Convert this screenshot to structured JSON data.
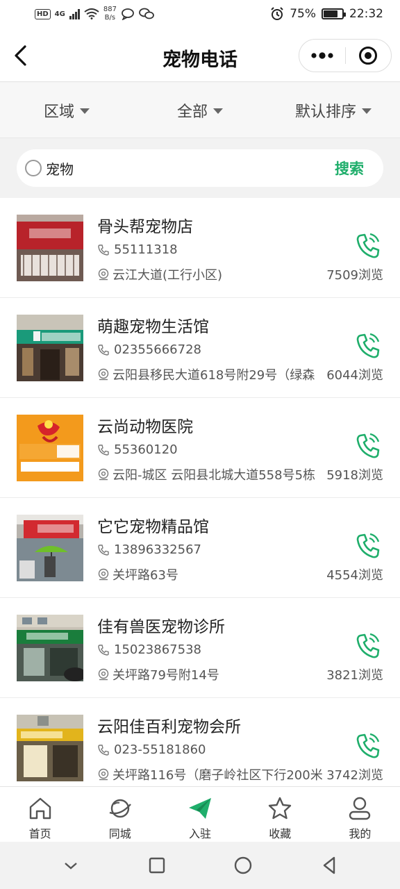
{
  "status": {
    "hd": "HD",
    "net": "4G",
    "speed_value": "887",
    "speed_unit": "B/s",
    "battery": "75%",
    "battery_level": 0.75,
    "time": "22:32"
  },
  "nav": {
    "title": "宠物电话"
  },
  "filters": [
    {
      "label": "区域"
    },
    {
      "label": "全部"
    },
    {
      "label": "默认排序"
    }
  ],
  "search": {
    "value": "宠物",
    "button": "搜索"
  },
  "items": [
    {
      "name": "骨头帮宠物店",
      "phone": "55111318",
      "address": "云江大道(工行小区)",
      "views": "7509浏览"
    },
    {
      "name": "萌趣宠物生活馆",
      "phone": "02355666728",
      "address": "云阳县移民大道618号附29号（绿森",
      "views": "6044浏览"
    },
    {
      "name": "云尚动物医院",
      "phone": "55360120",
      "address": "云阳-城区 云阳县北城大道558号5栋",
      "views": "5918浏览"
    },
    {
      "name": "它它宠物精品馆",
      "phone": "13896332567",
      "address": "关坪路63号",
      "views": "4554浏览"
    },
    {
      "name": "佳有兽医宠物诊所",
      "phone": "15023867538",
      "address": "关坪路79号附14号",
      "views": "3821浏览"
    },
    {
      "name": "云阳佳百利宠物会所",
      "phone": "023-55181860",
      "address": "关坪路116号（磨子岭社区下行200米",
      "views": "3742浏览"
    }
  ],
  "tabs": [
    {
      "label": "首页",
      "icon": "home-icon"
    },
    {
      "label": "同城",
      "icon": "planet-icon"
    },
    {
      "label": "入驻",
      "icon": "paper-plane-icon"
    },
    {
      "label": "收藏",
      "icon": "star-icon"
    },
    {
      "label": "我的",
      "icon": "user-icon"
    }
  ],
  "colors": {
    "accent": "#1fae6b",
    "text": "#222222",
    "muted": "#555555"
  }
}
